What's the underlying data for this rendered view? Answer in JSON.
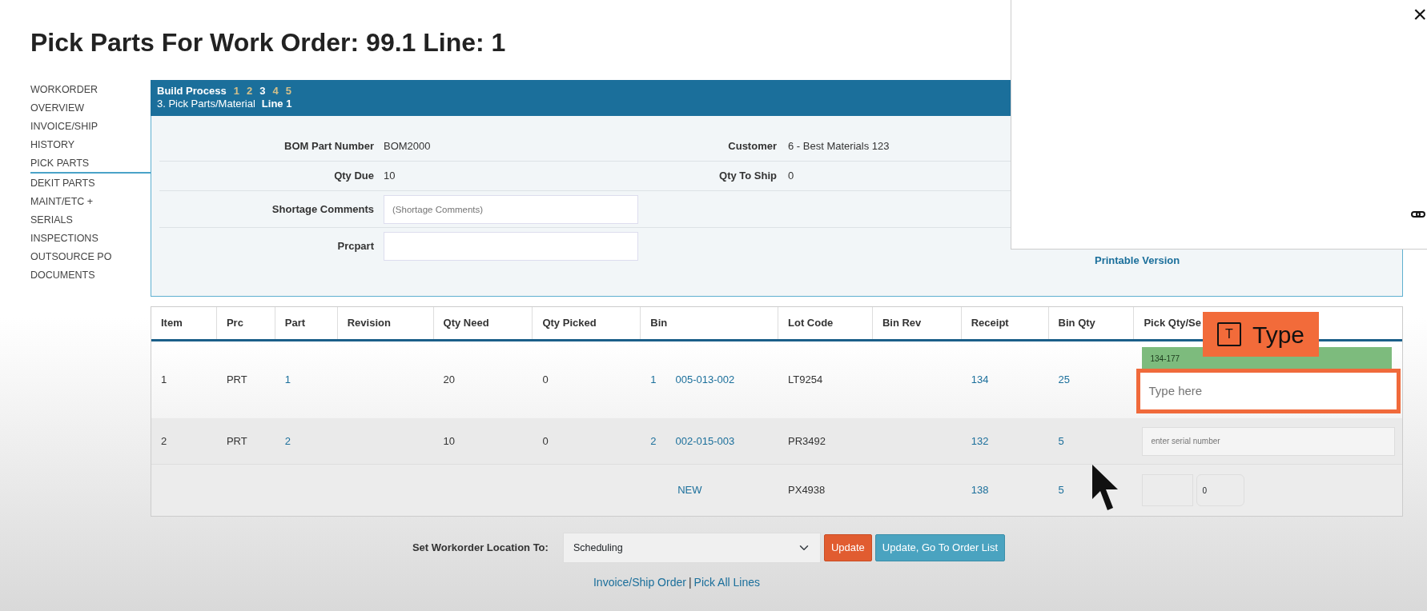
{
  "page_title": "Pick Parts For Work Order: 99.1 Line: 1",
  "sidebar": {
    "items": [
      {
        "label": "WORKORDER",
        "selected": false
      },
      {
        "label": "OVERVIEW",
        "selected": false
      },
      {
        "label": "INVOICE/SHIP",
        "selected": false
      },
      {
        "label": "HISTORY",
        "selected": false
      },
      {
        "label": "PICK PARTS",
        "selected": true
      },
      {
        "label": "DEKIT PARTS",
        "selected": false
      },
      {
        "label": "MAINT/ETC +",
        "selected": false
      },
      {
        "label": "SERIALS",
        "selected": false
      },
      {
        "label": "INSPECTIONS",
        "selected": false
      },
      {
        "label": "OUTSOURCE PO",
        "selected": false
      },
      {
        "label": "DOCUMENTS",
        "selected": false
      }
    ]
  },
  "build_process": {
    "title": "Build Process",
    "steps": [
      {
        "label": "1",
        "selected": false
      },
      {
        "label": "2",
        "selected": false
      },
      {
        "label": "3",
        "selected": true
      },
      {
        "label": "4",
        "selected": false
      },
      {
        "label": "5",
        "selected": false
      }
    ],
    "step_name": "3. Pick Parts/Material",
    "line": "Line 1"
  },
  "details": {
    "fields": [
      {
        "label": "BOM Part Number",
        "value": "BOM2000"
      },
      {
        "label": "Customer",
        "value": "6 - Best Materials 123"
      },
      {
        "label": "Qty Due",
        "value": "10"
      },
      {
        "label": "Qty To Ship",
        "value": "0"
      }
    ],
    "shortage_comments": {
      "label": "Shortage Comments",
      "placeholder": "(Shortage Comments)"
    },
    "prcpart": {
      "label": "Prcpart"
    },
    "printable_link": "Printable Version"
  },
  "table": {
    "columns": [
      "Item",
      "Prc",
      "Part",
      "Revision",
      "Qty Need",
      "Qty Picked",
      "Bin",
      "Lot Code",
      "Bin Rev",
      "Receipt",
      "Bin Qty",
      "Pick Qty/Se"
    ],
    "rows": [
      {
        "kind": "serial",
        "item": "1",
        "prc": "PRT",
        "part": "1",
        "qty_need": "20",
        "qty_picked": "0",
        "bin_no": "1",
        "bin": "005-013-002",
        "lot_code": "LT9254",
        "receipt": "134",
        "bin_qty": "25",
        "range": "134-177",
        "placeholder": "Type here",
        "highlighted": true
      },
      {
        "kind": "serial",
        "item": "2",
        "prc": "PRT",
        "part": "2",
        "qty_need": "10",
        "qty_picked": "0",
        "bin_no": "2",
        "bin": "002-015-003",
        "lot_code": "PR3492",
        "receipt": "132",
        "bin_qty": "5",
        "placeholder": "enter serial number",
        "highlighted": false
      },
      {
        "kind": "new",
        "bin": "NEW",
        "lot_code": "PX4938",
        "receipt": "138",
        "bin_qty": "5",
        "select_value": "0"
      }
    ]
  },
  "location": {
    "label": "Set Workorder Location To:",
    "value": "Scheduling"
  },
  "buttons": [
    {
      "label": "Update",
      "kind": "warning"
    },
    {
      "label": "Update, Go To Order List",
      "kind": "info"
    }
  ],
  "footer_links": {
    "links": [
      "Invoice/Ship Order",
      "Pick All Lines"
    ],
    "separator": "|"
  },
  "tooltip": {
    "icon_letter": "T",
    "label": "Type"
  },
  "overlay": {
    "close": "×"
  }
}
